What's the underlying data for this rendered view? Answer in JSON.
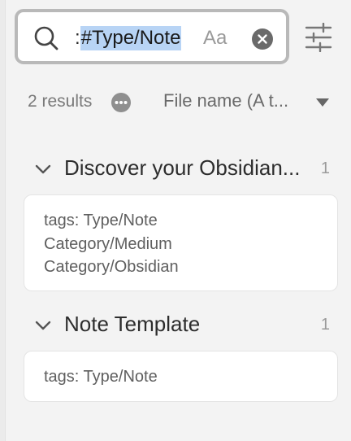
{
  "search": {
    "prefix": ":",
    "query": "#Type/Note",
    "case_toggle_label": "Aa"
  },
  "results_bar": {
    "count_label": "2 results",
    "sort_label": "File name (A t..."
  },
  "groups": [
    {
      "title": "Discover your Obsidian...",
      "count": "1",
      "matches": [
        "tags: Type/Note",
        "Category/Medium",
        "Category/Obsidian"
      ]
    },
    {
      "title": "Note Template",
      "count": "1",
      "matches": [
        "tags: Type/Note"
      ]
    }
  ],
  "icons": {
    "search": "search-icon",
    "clear": "clear-icon",
    "filter": "sliders-icon",
    "more": "more-icon",
    "sort": "chevron-down-icon",
    "collapse": "chevron-down-icon"
  },
  "colors": {
    "background": "#f3f3f3",
    "selection": "#b8d4f5",
    "card": "#ffffff"
  }
}
